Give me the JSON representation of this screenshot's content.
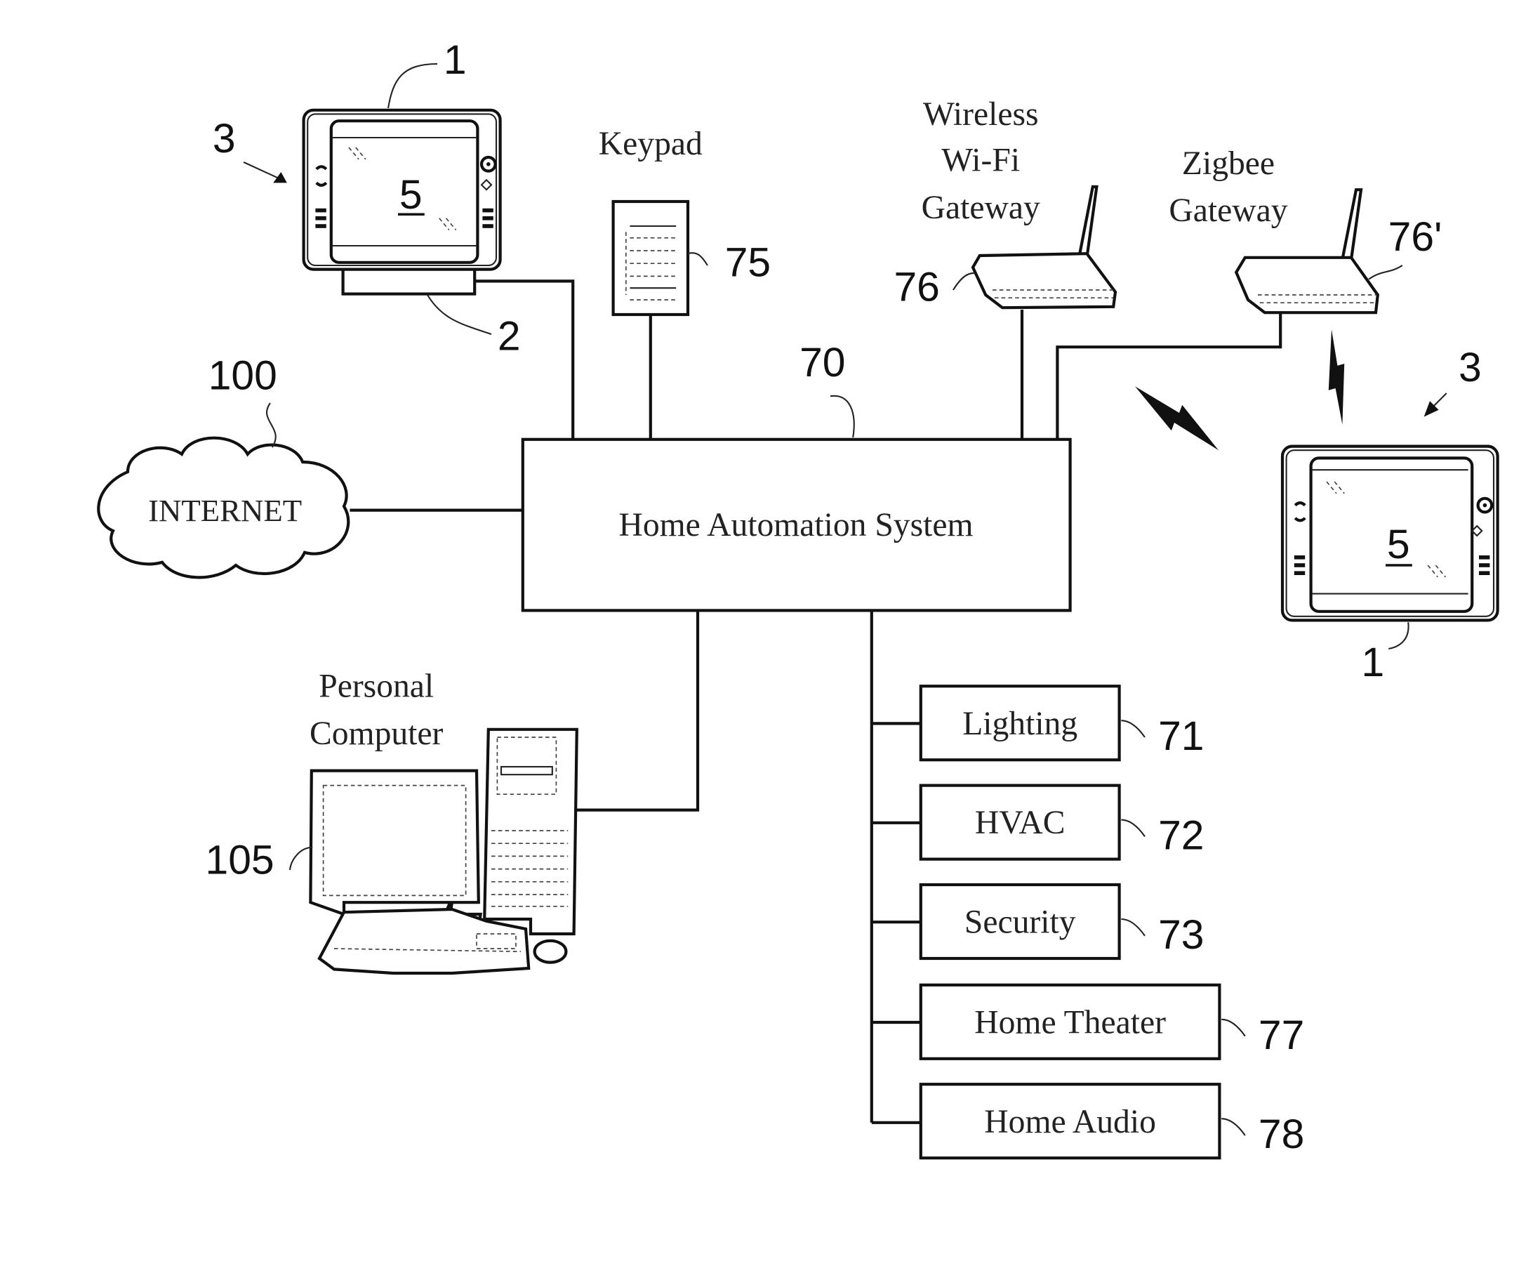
{
  "diagram": {
    "central": {
      "label": "Home Automation System",
      "ref": "70"
    },
    "internet": {
      "label": "INTERNET",
      "ref": "100"
    },
    "keypad": {
      "label": "Keypad",
      "ref": "75"
    },
    "wifi_gateway": {
      "line1": "Wireless",
      "line2": "Wi-Fi",
      "line3": "Gateway",
      "ref": "76"
    },
    "zigbee_gateway": {
      "line1": "Zigbee",
      "line2": "Gateway",
      "ref": "76'"
    },
    "personal_computer": {
      "line1": "Personal",
      "line2": "Computer",
      "ref": "105"
    },
    "docked_tablet": {
      "device_ref": "3",
      "body_ref": "1",
      "dock_ref": "2",
      "screen_ref": "5"
    },
    "wireless_tablet": {
      "device_ref": "3",
      "body_ref": "1",
      "screen_ref": "5"
    },
    "subsystems": [
      {
        "label": "Lighting",
        "ref": "71"
      },
      {
        "label": "HVAC",
        "ref": "72"
      },
      {
        "label": "Security",
        "ref": "73"
      },
      {
        "label": "Home Theater",
        "ref": "77"
      },
      {
        "label": "Home Audio",
        "ref": "78"
      }
    ]
  }
}
